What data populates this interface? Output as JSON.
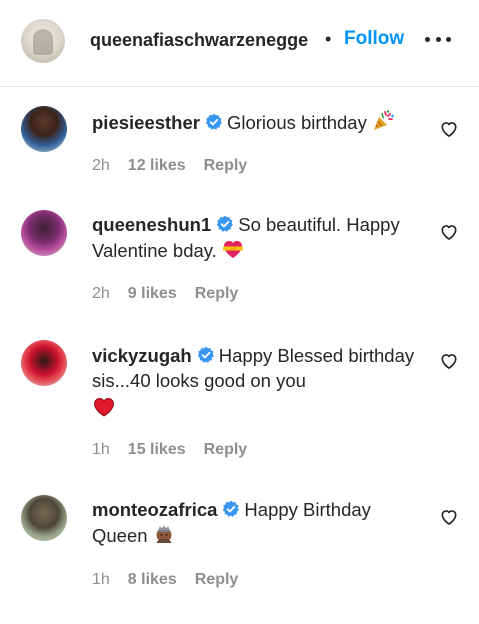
{
  "post": {
    "author": "queenafiaschwarzenegge",
    "separator": "•",
    "follow_label": "Follow"
  },
  "comments": [
    {
      "username": "piesieesther",
      "text": "Glorious birthday",
      "emoji": "party-popper",
      "time": "2h",
      "likes": "12 likes",
      "reply_label": "Reply"
    },
    {
      "username": "queeneshun1",
      "text": "So beautiful. Happy Valentine bday.",
      "emoji": "heart-with-ribbon",
      "time": "2h",
      "likes": "9 likes",
      "reply_label": "Reply"
    },
    {
      "username": "vickyzugah",
      "text": "Happy Blessed birthday sis...40 looks good on you",
      "emoji": "red-heart",
      "time": "1h",
      "likes": "15 likes",
      "reply_label": "Reply"
    },
    {
      "username": "monteozafrica",
      "text": "Happy Birthday Queen",
      "emoji": "person-crowned",
      "time": "1h",
      "likes": "8 likes",
      "reply_label": "Reply"
    }
  ],
  "colors": {
    "link_blue": "#0095f6",
    "verified_blue": "#3897f0",
    "meta_gray": "#8e8e8e",
    "text": "#262626"
  }
}
